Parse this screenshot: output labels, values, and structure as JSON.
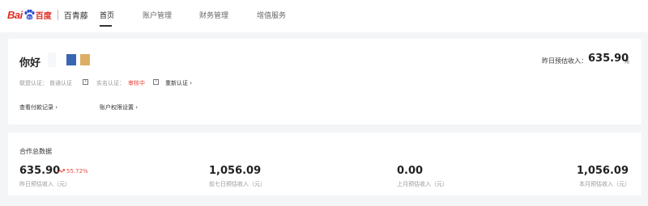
{
  "brand": {
    "logo_text": "Bai",
    "logo_text2": "百度",
    "product": "百青藤"
  },
  "nav": [
    {
      "label": "首页",
      "active": true
    },
    {
      "label": "账户管理",
      "active": false
    },
    {
      "label": "财务管理",
      "active": false
    },
    {
      "label": "增值服务",
      "active": false
    }
  ],
  "account": {
    "greeting": "你好",
    "union_label": "联盟认证：",
    "union_status": "普通认证",
    "realname_label": "实名认证：",
    "realname_status": "审核中",
    "reauth": "重新认证",
    "payment_link": "查看付款记录",
    "permission_link": "账户权限设置",
    "yesterday_label": "昨日预估收入：",
    "yesterday_value": "635.90",
    "yesterday_unit": "元"
  },
  "summary": {
    "title": "合作总数据",
    "metrics": [
      {
        "value": "635.90",
        "label": "昨日预估收入（元）",
        "change": "55.72%"
      },
      {
        "value": "1,056.09",
        "label": "前七日预估收入（元）"
      },
      {
        "value": "0.00",
        "label": "上月预估收入（元）"
      },
      {
        "value": "1,056.09",
        "label": "本月预估收入（元）"
      }
    ]
  },
  "colors": {
    "brand_red": "#e02b20",
    "trend_red": "#e8493f",
    "blue_block": "#3866b3",
    "gold_block": "#dcae66"
  }
}
